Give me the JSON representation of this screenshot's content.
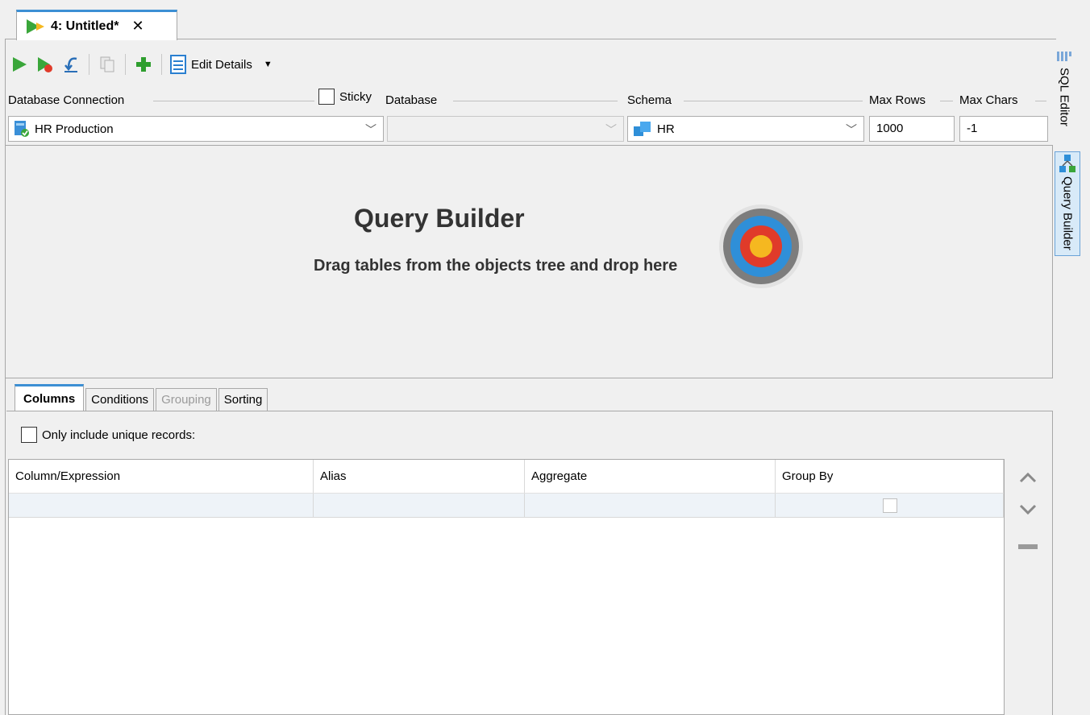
{
  "editor_tab": {
    "label": "4: Untitled*",
    "close": "✕"
  },
  "toolbar": {
    "edit_details_label": "Edit Details"
  },
  "connection_row": {
    "database_connection_label": "Database Connection",
    "sticky_label": "Sticky",
    "database_label": "Database",
    "schema_label": "Schema",
    "max_rows_label": "Max Rows",
    "max_chars_label": "Max Chars",
    "connection_value": "HR Production",
    "database_value": "",
    "schema_value": "HR",
    "max_rows_value": "1000",
    "max_chars_value": "-1"
  },
  "canvas": {
    "title": "Query Builder",
    "hint": "Drag tables from the objects tree and drop here"
  },
  "bottom_tabs": [
    {
      "label": "Columns",
      "state": "active"
    },
    {
      "label": "Conditions",
      "state": "normal"
    },
    {
      "label": "Grouping",
      "state": "disabled"
    },
    {
      "label": "Sorting",
      "state": "normal"
    }
  ],
  "columns_panel": {
    "unique_label": "Only include unique records:",
    "headers": [
      "Column/Expression",
      "Alias",
      "Aggregate",
      "Group By"
    ]
  },
  "right_strip": {
    "sql_editor": "SQL Editor",
    "query_builder": "Query Builder"
  },
  "colors": {
    "accent": "#3c8fd4",
    "run_green": "#3aa63a",
    "add_green": "#2e9e2e",
    "target_red": "#e03b2a",
    "target_blue": "#2f8fd8",
    "target_yellow": "#f5b820"
  }
}
